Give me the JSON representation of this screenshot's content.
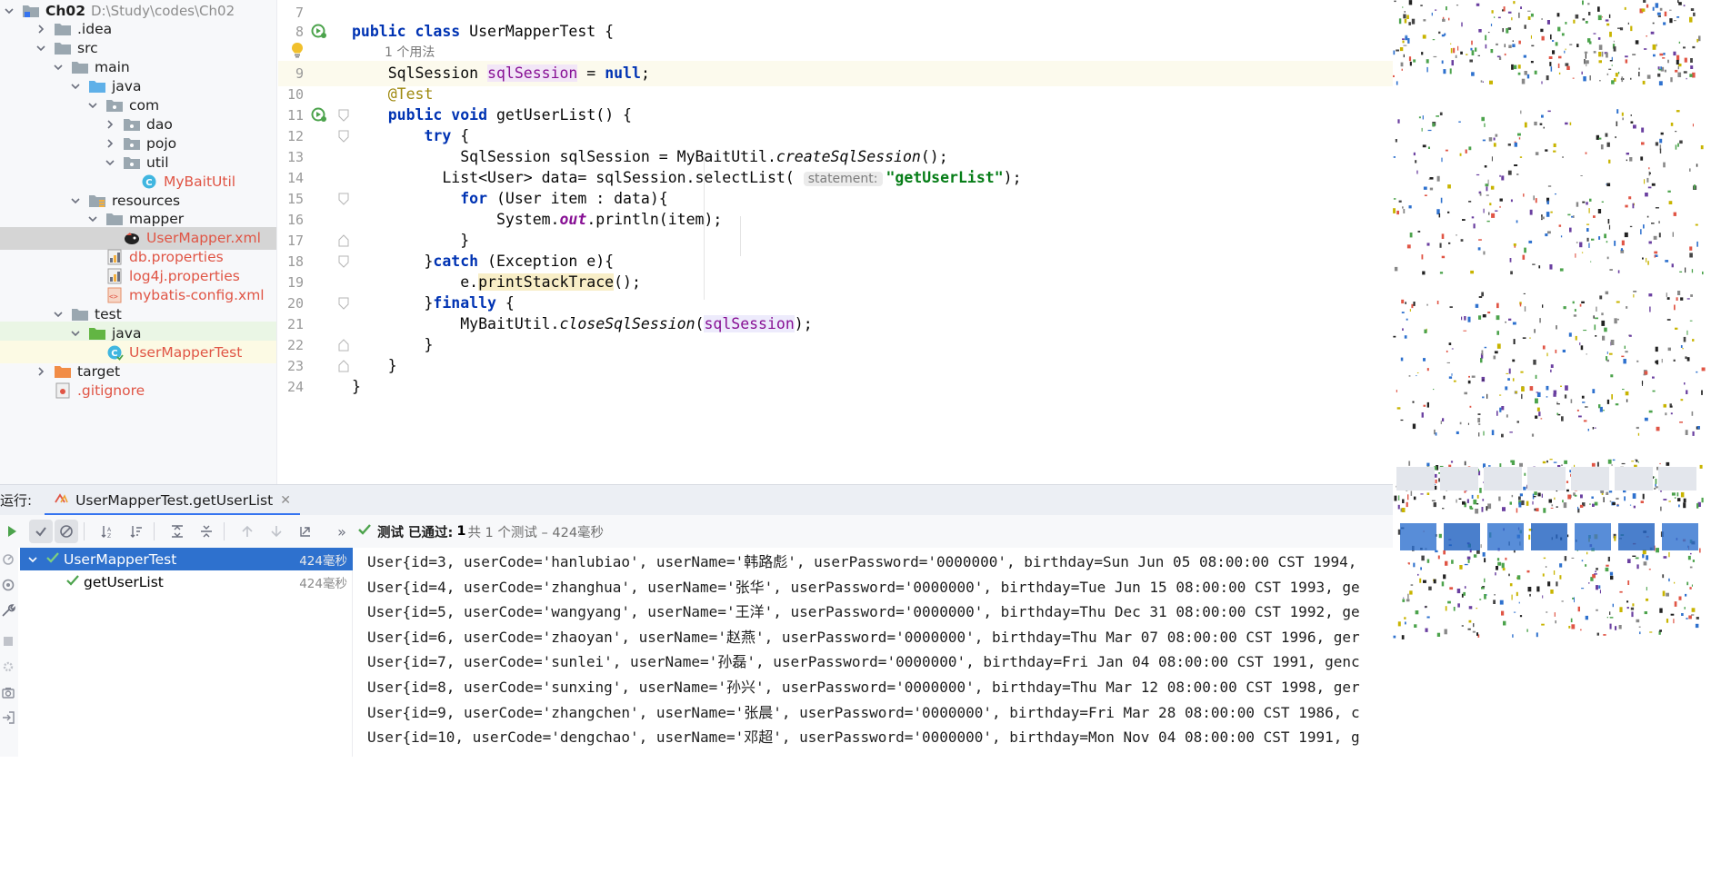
{
  "project": {
    "root_name": "Ch02",
    "root_path": "D:\\Study\\codes\\Ch02",
    "items": [
      {
        "label": "Ch02",
        "depth": 0,
        "expanded": true,
        "kind": "module-folder"
      },
      {
        "label": ".idea",
        "depth": 1,
        "expanded": false,
        "kind": "folder"
      },
      {
        "label": "src",
        "depth": 1,
        "expanded": true,
        "kind": "folder"
      },
      {
        "label": "main",
        "depth": 2,
        "expanded": true,
        "kind": "folder"
      },
      {
        "label": "java",
        "depth": 3,
        "expanded": true,
        "kind": "source-folder"
      },
      {
        "label": "com",
        "depth": 4,
        "expanded": true,
        "kind": "package"
      },
      {
        "label": "dao",
        "depth": 5,
        "expanded": false,
        "kind": "package"
      },
      {
        "label": "pojo",
        "depth": 5,
        "expanded": false,
        "kind": "package"
      },
      {
        "label": "util",
        "depth": 5,
        "expanded": true,
        "kind": "package"
      },
      {
        "label": "MyBaitUtil",
        "depth": 6,
        "kind": "class"
      },
      {
        "label": "resources",
        "depth": 3,
        "expanded": true,
        "kind": "resources-folder"
      },
      {
        "label": "mapper",
        "depth": 4,
        "expanded": true,
        "kind": "folder"
      },
      {
        "label": "UserMapper.xml",
        "depth": 5,
        "kind": "mybatis-xml"
      },
      {
        "label": "db.properties",
        "depth": 4,
        "kind": "properties"
      },
      {
        "label": "log4j.properties",
        "depth": 4,
        "kind": "properties"
      },
      {
        "label": "mybatis-config.xml",
        "depth": 4,
        "kind": "xml"
      },
      {
        "label": "test",
        "depth": 2,
        "expanded": true,
        "kind": "folder"
      },
      {
        "label": "java",
        "depth": 3,
        "expanded": true,
        "kind": "test-folder"
      },
      {
        "label": "UserMapperTest",
        "depth": 4,
        "kind": "test-class"
      },
      {
        "label": "target",
        "depth": 1,
        "expanded": false,
        "kind": "excluded-folder"
      },
      {
        "label": ".gitignore",
        "depth": 1,
        "kind": "gitignore"
      }
    ]
  },
  "editor": {
    "usage_hint": "1 个用法",
    "param_hint": "statement:",
    "lines": [
      {
        "n": "7"
      },
      {
        "n": "8"
      },
      {
        "n": "9"
      },
      {
        "n": "10"
      },
      {
        "n": "11"
      },
      {
        "n": "12"
      },
      {
        "n": "13"
      },
      {
        "n": "14"
      },
      {
        "n": "15"
      },
      {
        "n": "16"
      },
      {
        "n": "17"
      },
      {
        "n": "18"
      },
      {
        "n": "19"
      },
      {
        "n": "20"
      },
      {
        "n": "21"
      },
      {
        "n": "22"
      },
      {
        "n": "23"
      },
      {
        "n": "24"
      }
    ],
    "tokens": {
      "public": "public",
      "class": "class",
      "class_name": "UserMapperTest {",
      "sqlsession_type": "SqlSession ",
      "sqlsession_var": "sqlSession",
      "eq_null_pre": " = ",
      "null": "null",
      "semi": ";",
      "test_ann": "@Test",
      "void": "void",
      "method_sig": "getUserList() {",
      "try": "try",
      "brace_open": " {",
      "line13": "SqlSession sqlSession = MyBaitUtil.",
      "create_call": "createSqlSession",
      "call_end": "();",
      "line14a": "List<User> data= sqlSession.selectList(",
      "line14_str": "\"getUserList\"",
      "line14_end": ");",
      "for": "for",
      "line15": " (User item : data){",
      "line16a": "System.",
      "out": "out",
      "line16b": ".println(item);",
      "close": "}",
      "catch": "catch",
      "line18": " (Exception e){",
      "line19a": "e.",
      "print_stack": "printStackTrace",
      "line19b": "();",
      "finally": "finally",
      "line21a": "MyBaitUtil.",
      "close_call": "closeSqlSession",
      "paren_open": "(",
      "line21b": ");"
    }
  },
  "run_panel": {
    "label": "运行:",
    "tab_title": "UserMapperTest.getUserList",
    "status_prefix": "测试 已通过:",
    "status_count": "1",
    "status_detail": "共 1 个测试 – 424毫秒",
    "tests": [
      {
        "name": "UserMapperTest",
        "time": "424毫秒",
        "selected": true,
        "depth": 0
      },
      {
        "name": "getUserList",
        "time": "424毫秒",
        "selected": false,
        "depth": 1
      }
    ],
    "output": [
      "User{id=3, userCode='hanlubiao', userName='韩路彪', userPassword='0000000', birthday=Sun Jun 05 08:00:00 CST 1994,",
      "User{id=4, userCode='zhanghua', userName='张华', userPassword='0000000', birthday=Tue Jun 15 08:00:00 CST 1993, ge",
      "User{id=5, userCode='wangyang', userName='王洋', userPassword='0000000', birthday=Thu Dec 31 08:00:00 CST 1992, ge",
      "User{id=6, userCode='zhaoyan', userName='赵燕', userPassword='0000000', birthday=Thu Mar 07 08:00:00 CST 1996, ger",
      "User{id=7, userCode='sunlei', userName='孙磊', userPassword='0000000', birthday=Fri Jan 04 08:00:00 CST 1991, genc",
      "User{id=8, userCode='sunxing', userName='孙兴', userPassword='0000000', birthday=Thu Mar 12 08:00:00 CST 1998, ger",
      "User{id=9, userCode='zhangchen', userName='张晨', userPassword='0000000', birthday=Fri Mar 28 08:00:00 CST 1986, c",
      "User{id=10, userCode='dengchao', userName='邓超', userPassword='0000000', birthday=Mon Nov 04 08:00:00 CST 1991, g"
    ]
  },
  "colors": {
    "selection_blue": "#2e71ce",
    "keyword": "#0033b3",
    "string": "#067d17",
    "field": "#871094",
    "annotation": "#9e880d",
    "vcs_modified_red": "#e05545",
    "success_green": "#4ca34c"
  }
}
